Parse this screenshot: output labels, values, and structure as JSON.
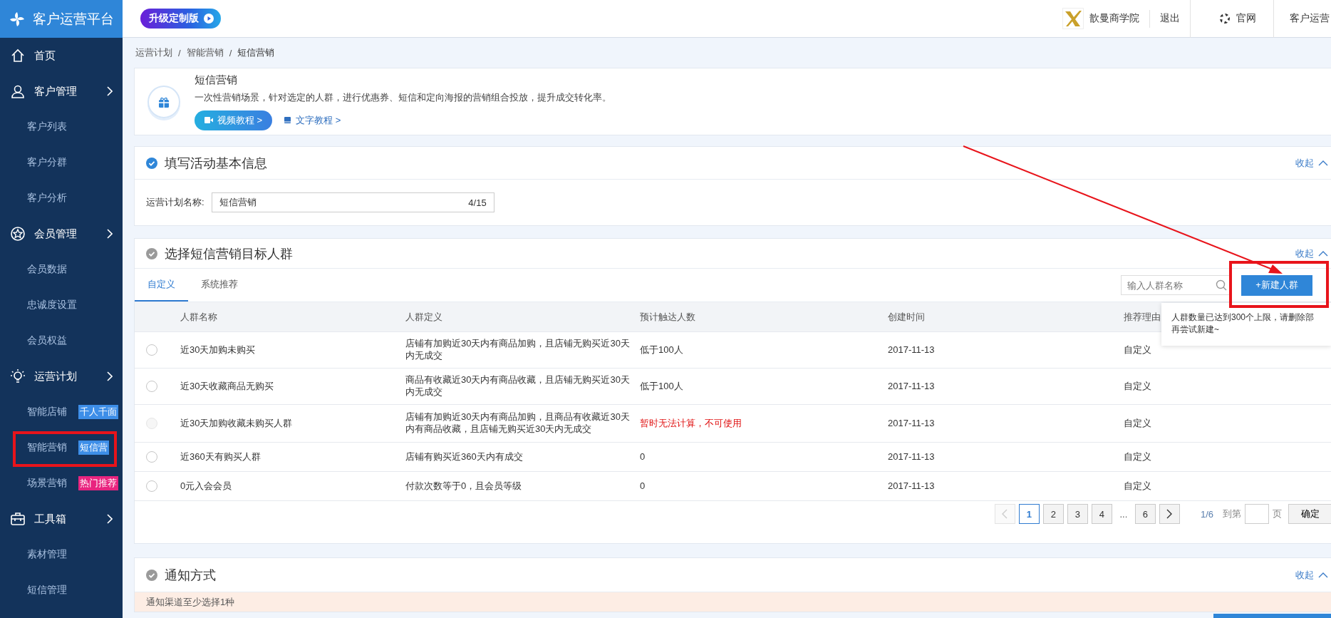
{
  "header": {
    "brand": "客户运营平台",
    "upgrade_badge": "升级定制版",
    "partner": "歆曼商学院",
    "logout": "退出",
    "website": "官网",
    "account": "客户运营"
  },
  "sidebar": {
    "items": [
      {
        "label": "首页"
      },
      {
        "label": "客户管理",
        "children": [
          {
            "label": "客户列表"
          },
          {
            "label": "客户分群"
          },
          {
            "label": "客户分析"
          }
        ]
      },
      {
        "label": "会员管理",
        "children": [
          {
            "label": "会员数据"
          },
          {
            "label": "忠诚度设置"
          },
          {
            "label": "会员权益"
          }
        ]
      },
      {
        "label": "运营计划",
        "children": [
          {
            "label": "智能店铺",
            "badge": "千人千面",
            "color": "#3d8ee8"
          },
          {
            "label": "智能营销",
            "badge": "短信营",
            "color": "#3d8ee8"
          },
          {
            "label": "场景营销",
            "badge": "热门推荐",
            "color": "#e8247f"
          }
        ]
      },
      {
        "label": "工具箱",
        "children": [
          {
            "label": "素材管理"
          },
          {
            "label": "短信管理"
          }
        ]
      }
    ]
  },
  "breadcrumb": {
    "items": [
      "运营计划",
      "智能营销",
      "短信营销"
    ],
    "separator": "/"
  },
  "intro": {
    "title": "短信营销",
    "description": "一次性营销场景，针对选定的人群，进行优惠券、短信和定向海报的营销组合投放，提升成交转化率。",
    "video_button": "视频教程 >",
    "text_link": "文字教程 >"
  },
  "basic_info": {
    "title": "填写活动基本信息",
    "done": true,
    "collapse": "收起",
    "field": {
      "label": "运营计划名称:",
      "value": "短信营销",
      "counter": "4/15"
    }
  },
  "audience": {
    "title": "选择短信营销目标人群",
    "done": false,
    "collapse": "收起",
    "tabs": [
      {
        "label": "自定义",
        "selected": true
      },
      {
        "label": "系统推荐",
        "selected": false
      }
    ],
    "search": {
      "placeholder": "输入人群名称"
    },
    "new_button": "+新建人群",
    "tooltip": {
      "lines": [
        "人群数量已达到300个上限，请删除部",
        "再尝试新建~"
      ]
    },
    "table": {
      "columns": [
        "人群名称",
        "人群定义",
        "预计触达人数",
        "创建时间",
        "推荐理由"
      ],
      "rows": [
        {
          "name": "近30天加购未购买",
          "definition": "店铺有加购近30天内有商品加购，且店铺无购买近30天内无成交",
          "reach": "低于100人",
          "reach_warning": false,
          "created": "2017-11-13",
          "reason": "自定义",
          "selected": false,
          "disabled": false
        },
        {
          "name": "近30天收藏商品无购买",
          "definition": "商品有收藏近30天内有商品收藏，且店铺无购买近30天内无成交",
          "reach": "低于100人",
          "reach_warning": false,
          "created": "2017-11-13",
          "reason": "自定义",
          "selected": false,
          "disabled": false
        },
        {
          "name": "近30天加购收藏未购买人群",
          "definition": "店铺有加购近30天内有商品加购，且商品有收藏近30天内有商品收藏，且店铺无购买近30天内无成交",
          "reach": "暂时无法计算，不可使用",
          "reach_warning": true,
          "created": "2017-11-13",
          "reason": "自定义",
          "selected": false,
          "disabled": true
        },
        {
          "name": "近360天有购买人群",
          "definition": "店铺有购买近360天内有成交",
          "reach": "0",
          "reach_warning": false,
          "created": "2017-11-13",
          "reason": "自定义",
          "selected": false,
          "disabled": false
        },
        {
          "name": "0元入会会员",
          "definition": "付款次数等于0，且会员等级",
          "reach": "0",
          "reach_warning": false,
          "created": "2017-11-13",
          "reason": "自定义",
          "selected": false,
          "disabled": false
        }
      ]
    },
    "pagination": {
      "prev_disabled": true,
      "next_disabled": false,
      "pages": [
        {
          "kind": "page",
          "label": "1",
          "selected": true
        },
        {
          "kind": "page",
          "label": "2",
          "selected": false
        },
        {
          "kind": "page",
          "label": "3",
          "selected": false
        },
        {
          "kind": "page",
          "label": "4",
          "selected": false
        },
        {
          "kind": "ellipsis",
          "label": "..."
        },
        {
          "kind": "page",
          "label": "6",
          "selected": false
        }
      ],
      "summary": "1/6",
      "goto_label": "到第",
      "page_unit": "页",
      "confirm": "确定"
    }
  },
  "notice": {
    "title": "通知方式",
    "done": false,
    "collapse": "收起",
    "warning": "通知渠道至少选择1种"
  }
}
